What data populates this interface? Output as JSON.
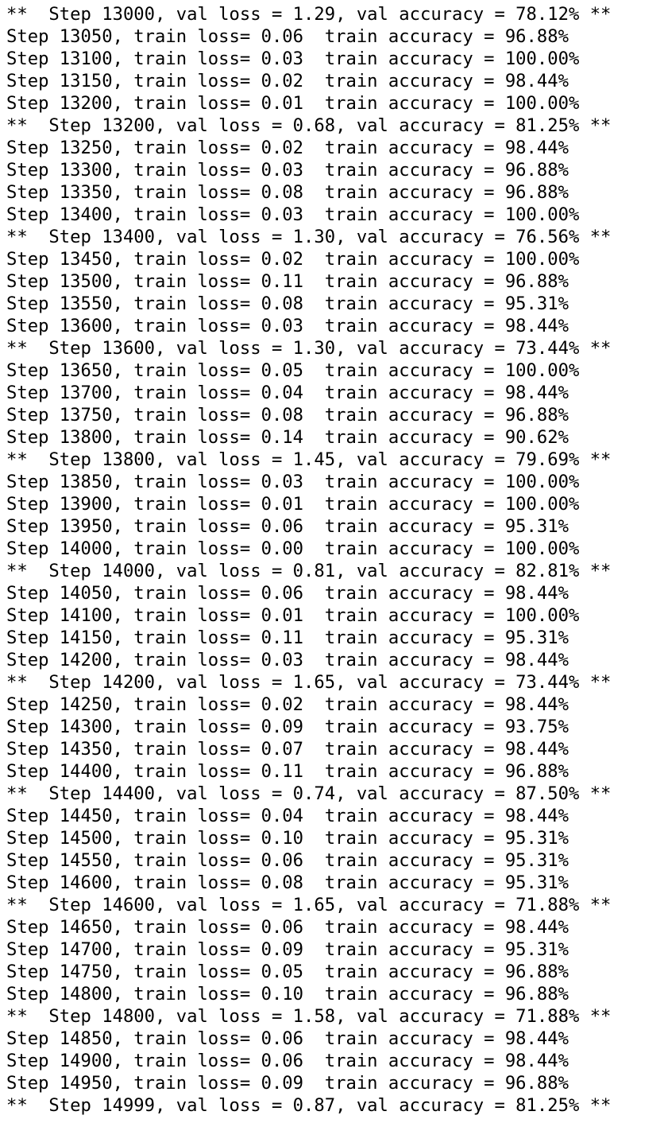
{
  "terminal": {
    "lines": [
      "**  Step 13000, val loss = 1.29, val accuracy = 78.12% **",
      "Step 13050, train loss= 0.06  train accuracy = 96.88%",
      "Step 13100, train loss= 0.03  train accuracy = 100.00%",
      "Step 13150, train loss= 0.02  train accuracy = 98.44%",
      "Step 13200, train loss= 0.01  train accuracy = 100.00%",
      "**  Step 13200, val loss = 0.68, val accuracy = 81.25% **",
      "Step 13250, train loss= 0.02  train accuracy = 98.44%",
      "Step 13300, train loss= 0.03  train accuracy = 96.88%",
      "Step 13350, train loss= 0.08  train accuracy = 96.88%",
      "Step 13400, train loss= 0.03  train accuracy = 100.00%",
      "**  Step 13400, val loss = 1.30, val accuracy = 76.56% **",
      "Step 13450, train loss= 0.02  train accuracy = 100.00%",
      "Step 13500, train loss= 0.11  train accuracy = 96.88%",
      "Step 13550, train loss= 0.08  train accuracy = 95.31%",
      "Step 13600, train loss= 0.03  train accuracy = 98.44%",
      "**  Step 13600, val loss = 1.30, val accuracy = 73.44% **",
      "Step 13650, train loss= 0.05  train accuracy = 100.00%",
      "Step 13700, train loss= 0.04  train accuracy = 98.44%",
      "Step 13750, train loss= 0.08  train accuracy = 96.88%",
      "Step 13800, train loss= 0.14  train accuracy = 90.62%",
      "**  Step 13800, val loss = 1.45, val accuracy = 79.69% **",
      "Step 13850, train loss= 0.03  train accuracy = 100.00%",
      "Step 13900, train loss= 0.01  train accuracy = 100.00%",
      "Step 13950, train loss= 0.06  train accuracy = 95.31%",
      "Step 14000, train loss= 0.00  train accuracy = 100.00%",
      "**  Step 14000, val loss = 0.81, val accuracy = 82.81% **",
      "Step 14050, train loss= 0.06  train accuracy = 98.44%",
      "Step 14100, train loss= 0.01  train accuracy = 100.00%",
      "Step 14150, train loss= 0.11  train accuracy = 95.31%",
      "Step 14200, train loss= 0.03  train accuracy = 98.44%",
      "**  Step 14200, val loss = 1.65, val accuracy = 73.44% **",
      "Step 14250, train loss= 0.02  train accuracy = 98.44%",
      "Step 14300, train loss= 0.09  train accuracy = 93.75%",
      "Step 14350, train loss= 0.07  train accuracy = 98.44%",
      "Step 14400, train loss= 0.11  train accuracy = 96.88%",
      "**  Step 14400, val loss = 0.74, val accuracy = 87.50% **",
      "Step 14450, train loss= 0.04  train accuracy = 98.44%",
      "Step 14500, train loss= 0.10  train accuracy = 95.31%",
      "Step 14550, train loss= 0.06  train accuracy = 95.31%",
      "Step 14600, train loss= 0.08  train accuracy = 95.31%",
      "**  Step 14600, val loss = 1.65, val accuracy = 71.88% **",
      "Step 14650, train loss= 0.06  train accuracy = 98.44%",
      "Step 14700, train loss= 0.09  train accuracy = 95.31%",
      "Step 14750, train loss= 0.05  train accuracy = 96.88%",
      "Step 14800, train loss= 0.10  train accuracy = 96.88%",
      "**  Step 14800, val loss = 1.58, val accuracy = 71.88% **",
      "Step 14850, train loss= 0.06  train accuracy = 98.44%",
      "Step 14900, train loss= 0.06  train accuracy = 98.44%",
      "Step 14950, train loss= 0.09  train accuracy = 96.88%",
      "**  Step 14999, val loss = 0.87, val accuracy = 81.25% **"
    ]
  }
}
